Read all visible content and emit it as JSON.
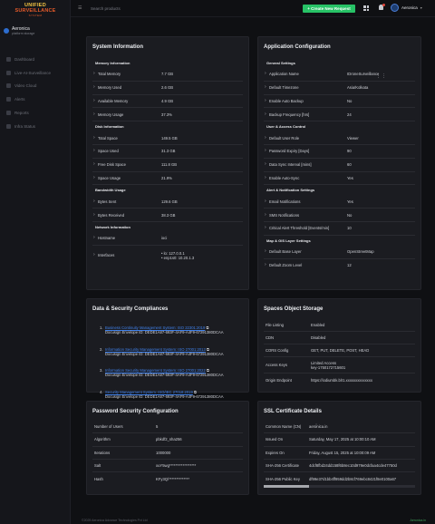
{
  "sidebar": {
    "logo": {
      "line1": "UNIFIED",
      "line2": "SURVEILLANCE",
      "line3": "SYSTEM"
    },
    "org_name": "Aeronica",
    "org_sub": "platform storage",
    "items": [
      {
        "label": "Dashboard",
        "icon": "dashboard-icon"
      },
      {
        "label": "Live-AI-Surveillance",
        "icon": "camera-icon"
      },
      {
        "label": "Video Cloud",
        "icon": "cloud-icon"
      },
      {
        "label": "Alerts",
        "icon": "alert-icon"
      },
      {
        "label": "Reports",
        "icon": "report-icon"
      },
      {
        "label": "Infra Status",
        "icon": "server-icon"
      }
    ]
  },
  "topbar": {
    "search_placeholder": "Search products",
    "create_label": "+ Create New Request",
    "user_name": "Aeronica"
  },
  "system": {
    "title": "System Information",
    "memory_header": "Memory Information",
    "memory": [
      {
        "k": "Total Memory",
        "v": "7.7 GB"
      },
      {
        "k": "Memory Used",
        "v": "2.6 GB"
      },
      {
        "k": "Available Memory",
        "v": "4.9 GB"
      },
      {
        "k": "Memory Usage",
        "v": "37.3%"
      }
    ],
    "disk_header": "Disk Information",
    "disk": [
      {
        "k": "Total Space",
        "v": "149.5 GB"
      },
      {
        "k": "Space Used",
        "v": "31.3 GB"
      },
      {
        "k": "Free Disk Space",
        "v": "111.8 GB"
      },
      {
        "k": "Space Usage",
        "v": "21.9%"
      }
    ],
    "bandwidth_header": "Bandwidth Usage",
    "bandwidth": [
      {
        "k": "Bytes Sent",
        "v": "129.6 GB"
      },
      {
        "k": "Bytes Received",
        "v": "38.3 GB"
      }
    ],
    "network_header": "Network Information",
    "hostname": {
      "k": "Hostname",
      "v": "ioci"
    },
    "interfaces": {
      "k": "Interfaces",
      "v1": "• lo: 127.0.0.1",
      "v2": "• enp1s0: 10.20.1.3"
    }
  },
  "appconfig": {
    "title": "Application Configuration",
    "general_header": "General Settings",
    "general": [
      {
        "k": "Application Name",
        "v": "IDroneSurveillance"
      },
      {
        "k": "Default Timezone",
        "v": "Asia/Kolkata"
      },
      {
        "k": "Enable Auto Backup",
        "v": "No"
      },
      {
        "k": "Backup Frequency [hrs]",
        "v": "24"
      }
    ],
    "access_header": "User & Access Control",
    "access": [
      {
        "k": "Default User Role",
        "v": "Viewer"
      },
      {
        "k": "Password Expiry [Days]",
        "v": "90"
      },
      {
        "k": "Data Sync Interval [mins]",
        "v": "60"
      },
      {
        "k": "Enable Auto-Sync",
        "v": "Yes"
      }
    ],
    "alert_header": "Alert & Notification Settings",
    "alert": [
      {
        "k": "Email Notifications",
        "v": "Yes"
      },
      {
        "k": "SMS Notifications",
        "v": "No"
      },
      {
        "k": "Critical Alert Threshold [Events/min]",
        "v": "10"
      }
    ],
    "map_header": "Map & GIS Layer Settings",
    "map": [
      {
        "k": "Default Base Layer",
        "v": "OpenStreetMap"
      },
      {
        "k": "Default Zoom Level",
        "v": "12"
      }
    ]
  },
  "compliance": {
    "title": "Data & Security Compliances",
    "items": [
      {
        "no": "1.",
        "title": "Business Continuity Management System: ISO 22301:2019",
        "env": "Docusign Envelope ID: DEDE1A87-693F-4AF9-A4F9-67291380DCAA"
      },
      {
        "no": "2.",
        "title": "Information Security Management System: ISO 27001:2013",
        "env": "Docusign Envelope ID: DEDE1A87-693F-4AF9-A4F9-67291380DCAA"
      },
      {
        "no": "3.",
        "title": "Information Security Management System: ISO 27001:2022",
        "env": "Docusign Envelope ID: DEDE1A87-693F-4AF9-A4F9-67291380DCAA"
      },
      {
        "no": "4.",
        "title": "Security Management System: ISO/IEC 27018:2019",
        "env": "Docusign Envelope ID: DEDE1A87-693F-4AF9-A4F9-67291380DCAA"
      }
    ]
  },
  "storage": {
    "title": "Spaces Object Storage",
    "rows": [
      {
        "k": "File Listing",
        "v": "Enabled"
      },
      {
        "k": "CDN",
        "v": "Disabled"
      },
      {
        "k": "CORS Config",
        "v": "GET, PUT, DELETE, POST, HEAD"
      },
      {
        "k": "Access Keys",
        "v1": "Limited Access",
        "v2": "key-1750172715601"
      },
      {
        "k": "Origin Endpoint",
        "v": "https://iodiumbk.blr1.xxxxxxxxxxxxxx"
      }
    ]
  },
  "password": {
    "title": "Password Security Configuration",
    "rows": [
      {
        "k": "Number of Users",
        "v": "5"
      },
      {
        "k": "Algorithm",
        "v": "pbkdf2_sha256"
      },
      {
        "k": "Iterations",
        "v": "1000000"
      },
      {
        "k": "Salt",
        "v": "xuY5wg******************"
      },
      {
        "k": "Hash",
        "v": "KFy3Q/**************"
      }
    ]
  },
  "ssl": {
    "title": "SSL Certificate Details",
    "rows": [
      {
        "k": "Common Name (CN)",
        "v": "aeronica.in"
      },
      {
        "k": "Issued On",
        "v": "Saturday, May 17, 2025 at 10:00:10 AM"
      },
      {
        "k": "Expires On",
        "v": "Friday, August 15, 2025 at 10:00:09 AM"
      },
      {
        "k": "SHA-256 Certificate",
        "v": "4dcf8fbd24dd158f6b8ec10d979e0dcfaa4cde47750d"
      },
      {
        "k": "SHA-256 Public Key",
        "v": "df99e37d1bb4ff959dd2b8cf769ebc8421f8e0100a67"
      }
    ]
  },
  "footer": {
    "copyright": "©2025 Aeronica Advance Technologies Pvt Ltd",
    "brand": "Aeronica.in"
  }
}
